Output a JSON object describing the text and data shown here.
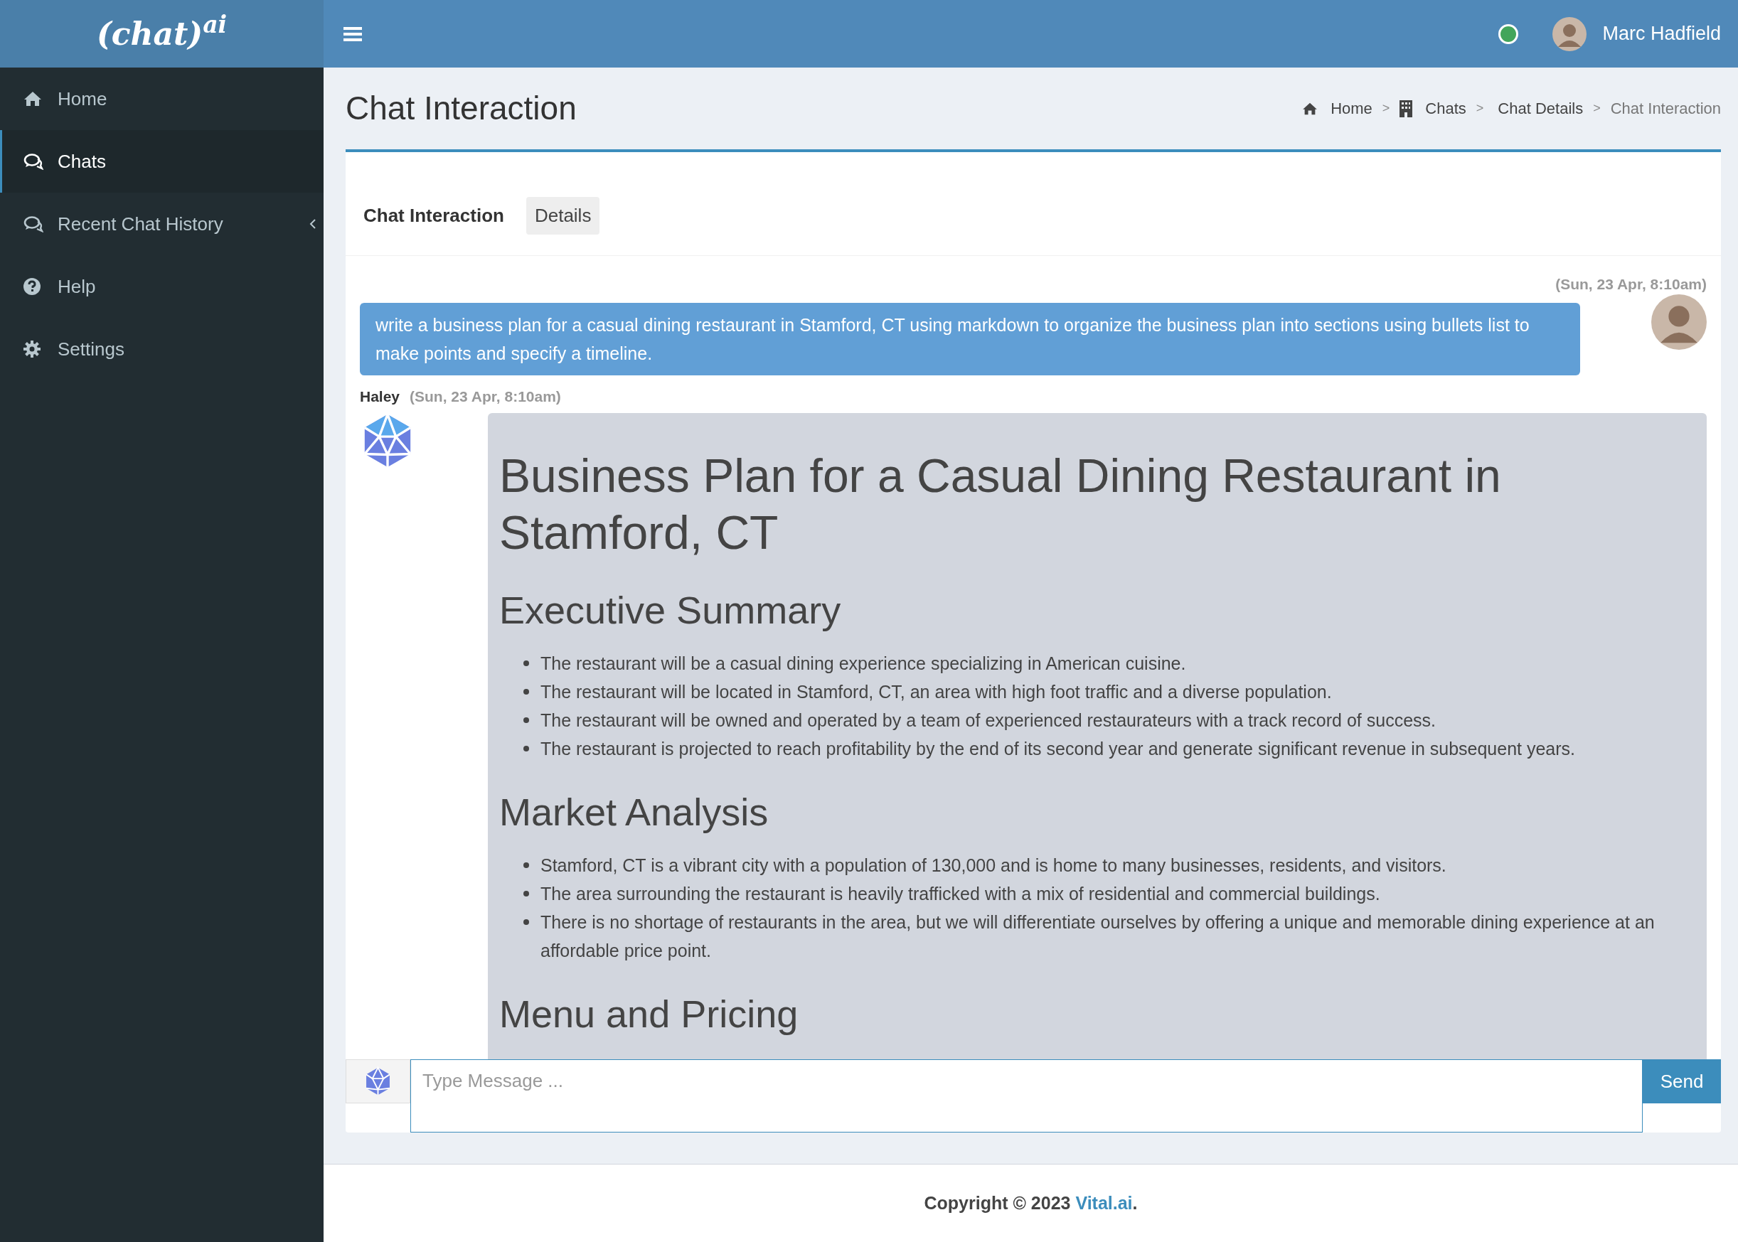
{
  "logo": "(chat)$^{ai}$",
  "sidebar": {
    "items": [
      {
        "label": "Home",
        "kind": "link",
        "selected": false
      },
      {
        "label": "Chats",
        "kind": "link",
        "selected": true
      },
      {
        "label": "Recent Chat History",
        "kind": "submenu",
        "selected": false
      },
      {
        "label": "Help",
        "kind": "link",
        "selected": false
      },
      {
        "label": "Settings",
        "kind": "link",
        "selected": false
      }
    ]
  },
  "header": {
    "online": true,
    "user": "Marc Hadfield"
  },
  "page": {
    "title": "Chat Interaction",
    "breadcrumb": [
      {
        "label": "Home",
        "current": false
      },
      {
        "sep": ">",
        "label": "Chats",
        "current": false
      },
      {
        "sep": ">",
        "label": "Chat Details",
        "current": false
      },
      {
        "sep": ">",
        "label": "Chat Interaction",
        "current": true
      }
    ]
  },
  "tabs": [
    {
      "label": "Chat Interaction",
      "selected": true
    },
    {
      "label": "Details",
      "selected": false
    }
  ],
  "messages": [
    {
      "kind": "user",
      "time": "(Sun, 23 Apr, 8:10am)",
      "text": "write a business plan for a casual dining restaurant in Stamford, CT using markdown to organize the business plan into sections using bullets list to make points and specify a timeline."
    },
    {
      "kind": "bot",
      "sender": "Haley",
      "time": "(Sun, 23 Apr, 8:10am)",
      "content": [
        {
          "kind": "h1",
          "text": "Business Plan for a Casual Dining Restaurant in Stamford, CT"
        },
        {
          "kind": "h2",
          "text": "Executive Summary"
        },
        {
          "kind": "list",
          "items": [
            "The restaurant will be a casual dining experience specializing in American cuisine.",
            "The restaurant will be located in Stamford, CT, an area with high foot traffic and a diverse population.",
            "The restaurant will be owned and operated by a team of experienced restaurateurs with a track record of success.",
            "The restaurant is projected to reach profitability by the end of its second year and generate significant revenue in subsequent years."
          ]
        },
        {
          "kind": "h2",
          "text": "Market Analysis"
        },
        {
          "kind": "list",
          "items": [
            "Stamford, CT is a vibrant city with a population of 130,000 and is home to many businesses, residents, and visitors.",
            "The area surrounding the restaurant is heavily trafficked with a mix of residential and commercial buildings.",
            "There is no shortage of restaurants in the area, but we will differentiate ourselves by offering a unique and memorable dining experience at an affordable price point."
          ]
        },
        {
          "kind": "h2",
          "text": "Menu and Pricing"
        }
      ]
    }
  ],
  "composer": {
    "placeholder": "Type Message ...",
    "button": "Send"
  },
  "footer": {
    "prefix": "Copyright © 2023",
    "link": "Vital.ai",
    "suffix": "."
  }
}
